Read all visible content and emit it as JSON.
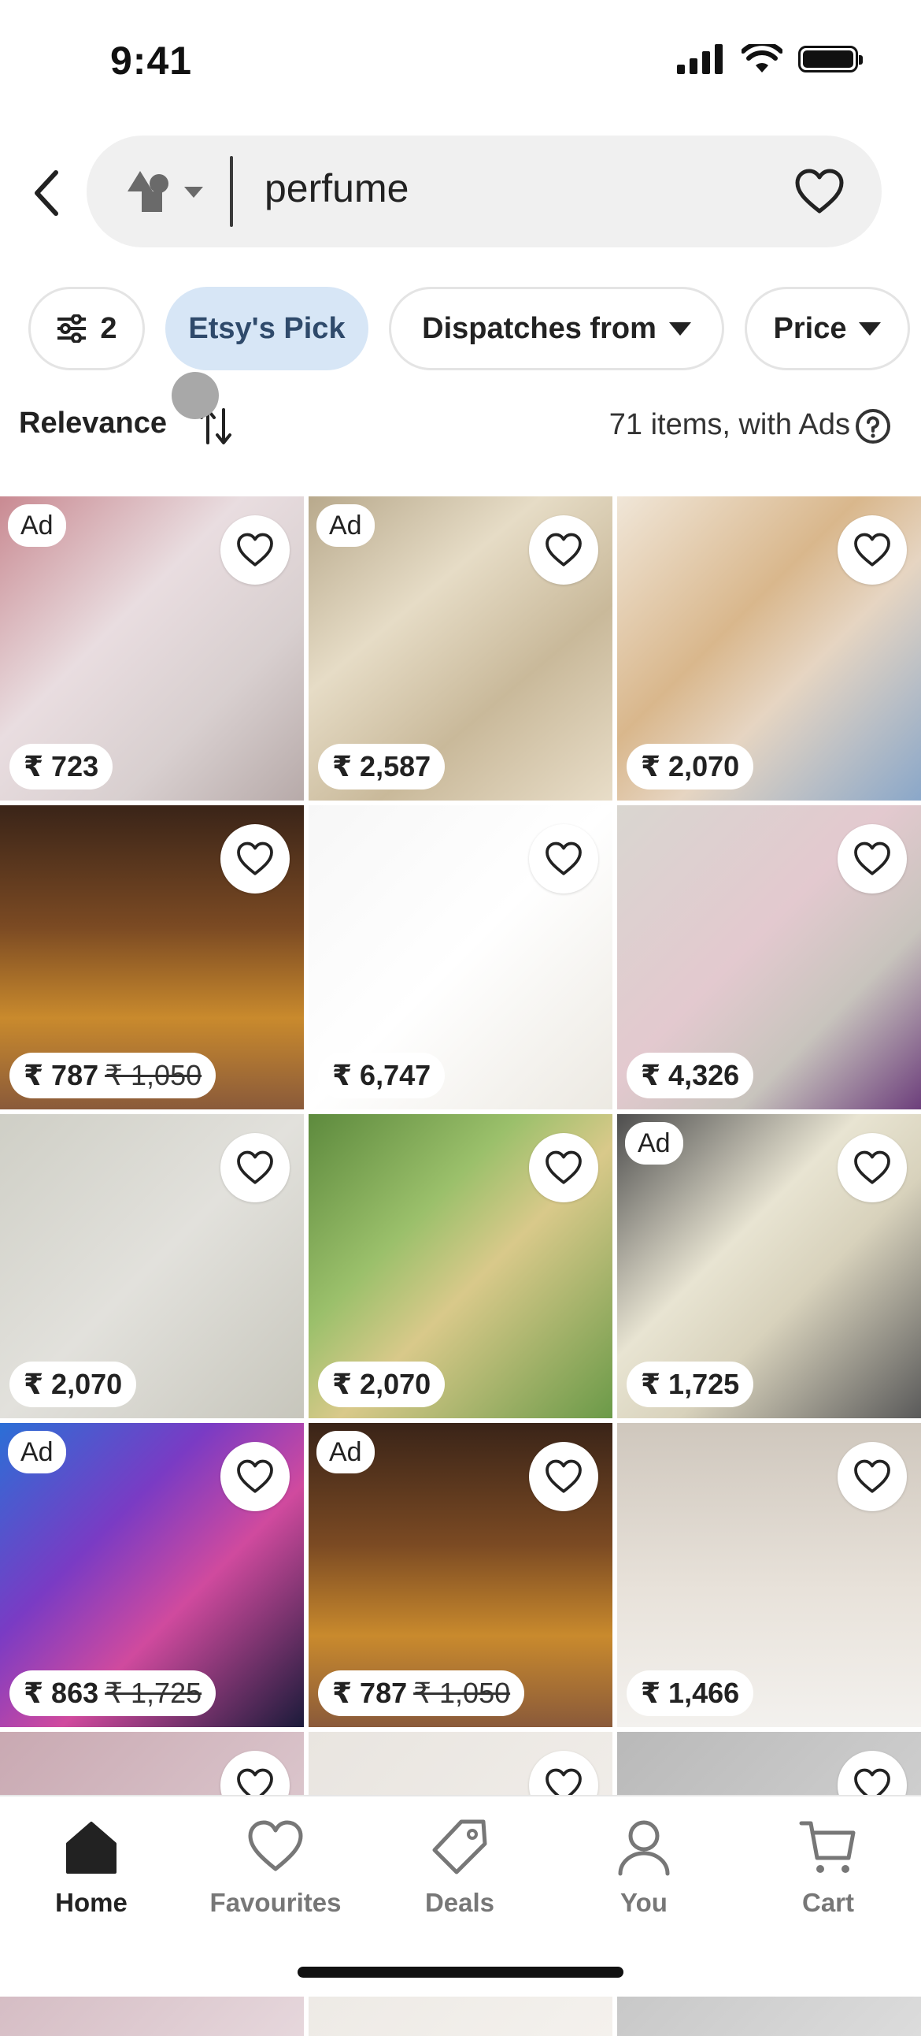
{
  "status_bar": {
    "time": "9:41"
  },
  "search": {
    "query": "perfume"
  },
  "filters": {
    "count_badge": "2",
    "chips": [
      "Etsy's Pick",
      "Dispatches from",
      "Price"
    ]
  },
  "sort": {
    "label": "Relevance",
    "results_text": "71 items, with Ads"
  },
  "listings": [
    {
      "ad": "Ad",
      "price": "₹ 723",
      "original_price": "",
      "bg": "linear-gradient(135deg,#c98a92 0%,#e9dde0 40%,#d8cfcf 70%,#b7aaa9 100%)"
    },
    {
      "ad": "Ad",
      "price": "₹ 2,587",
      "original_price": "",
      "bg": "linear-gradient(140deg,#b8a98c 0%,#e6dcc6 35%,#c9b99a 65%,#e8ddc8 100%)"
    },
    {
      "ad": "",
      "price": "₹ 2,070",
      "original_price": "",
      "bg": "linear-gradient(135deg,#f0e6d8 0%,#d9b78c 40%,#e6d5c2 60%,#8aa7c9 100%)"
    },
    {
      "ad": "",
      "price": "₹ 787",
      "original_price": "₹ 1,050",
      "bg": "linear-gradient(180deg,#3a2418 0%,#7b4a23 40%,#c98a2d 70%,#8a5a3a 100%)"
    },
    {
      "ad": "",
      "price": "₹ 6,747",
      "original_price": "",
      "bg": "linear-gradient(135deg,#f7f7f7 0%,#ffffff 50%,#ece9e2 100%)"
    },
    {
      "ad": "",
      "price": "₹ 4,326",
      "original_price": "",
      "bg": "linear-gradient(135deg,#d9d6d0 0%,#e3c9cf 45%,#c8c4bd 70%,#6d3f7c 100%)"
    },
    {
      "ad": "",
      "price": "₹ 2,070",
      "original_price": "",
      "bg": "linear-gradient(135deg,#cfcfc6 0%,#e2e1dc 50%,#c7c6bc 100%)"
    },
    {
      "ad": "",
      "price": "₹ 2,070",
      "original_price": "",
      "bg": "linear-gradient(135deg,#5d8a3d 0%,#9bc06b 35%,#d9c98a 55%,#6b9a48 100%)"
    },
    {
      "ad": "Ad",
      "price": "₹ 1,725",
      "original_price": "",
      "bg": "linear-gradient(135deg,#4d4d4d 0%,#e8e4d2 40%,#d8d2bc 60%,#5a5a5a 100%)"
    },
    {
      "ad": "Ad",
      "price": "₹ 863",
      "original_price": "₹ 1,725",
      "bg": "linear-gradient(135deg,#2b6fd6 0%,#7a3bc4 35%,#d04a9e 60%,#1b1b3a 100%)"
    },
    {
      "ad": "Ad",
      "price": "₹ 787",
      "original_price": "₹ 1,050",
      "bg": "linear-gradient(180deg,#3a2418 0%,#7b4a23 40%,#c98a2d 70%,#8a5a3a 100%)"
    },
    {
      "ad": "",
      "price": "₹ 1,466",
      "original_price": "",
      "bg": "linear-gradient(180deg,#cfc7bd 0%,#e8e2da 55%,#f3f1ee 100%)"
    },
    {
      "ad": "",
      "price": "",
      "original_price": "",
      "bg": "linear-gradient(135deg,#c9a9b2 0%,#e6d7dc 100%)"
    },
    {
      "ad": "",
      "price": "",
      "original_price": "",
      "bg": "linear-gradient(135deg,#e9e5e0 0%,#f4f1ed 100%)"
    },
    {
      "ad": "",
      "price": "",
      "original_price": "",
      "bg": "linear-gradient(135deg,#b9b9b9 0%,#dcdcdc 100%)"
    }
  ],
  "nav": {
    "items": [
      {
        "label": "Home",
        "icon": "home-icon"
      },
      {
        "label": "Favourites",
        "icon": "heart-icon"
      },
      {
        "label": "Deals",
        "icon": "tag-icon"
      },
      {
        "label": "You",
        "icon": "person-icon"
      },
      {
        "label": "Cart",
        "icon": "cart-icon"
      }
    ]
  },
  "colors": {
    "active_chip_bg": "#d7e6f6",
    "search_bg": "#f0f0f0",
    "nav_inactive": "#777777"
  }
}
